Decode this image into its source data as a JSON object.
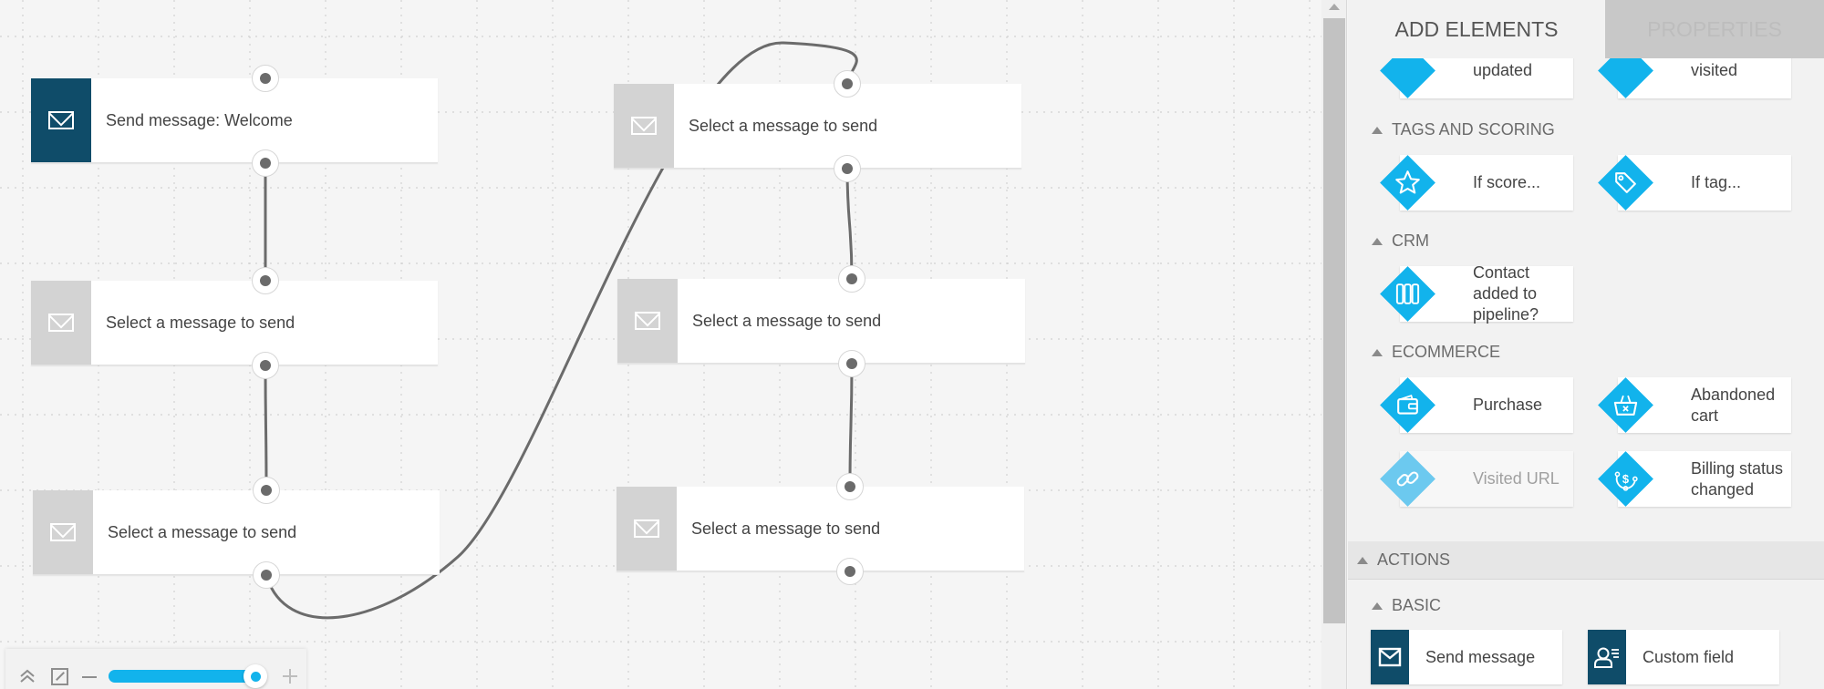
{
  "canvas": {
    "nodes": [
      {
        "label": "Send message: Welcome",
        "state": "active"
      },
      {
        "label": "Select a message to send",
        "state": "empty"
      },
      {
        "label": "Select a message to send",
        "state": "empty"
      },
      {
        "label": "Select a message to send",
        "state": "empty"
      },
      {
        "label": "Select a message to send",
        "state": "empty"
      },
      {
        "label": "Select a message to send",
        "state": "empty"
      }
    ],
    "connections": [
      {
        "from": 0,
        "to": 1
      },
      {
        "from": 1,
        "to": 2
      },
      {
        "from": 2,
        "to": 3
      },
      {
        "from": 3,
        "to": 4
      },
      {
        "from": 4,
        "to": 5
      }
    ],
    "zoom": {
      "collapse_icon": "double-chevron-up-icon",
      "fit_icon": "expand-icon",
      "minus_icon": "minus-icon",
      "plus_icon": "plus-icon",
      "level_fraction": 0.9
    }
  },
  "panel": {
    "tabs": [
      {
        "label": "ADD ELEMENTS",
        "active": true
      },
      {
        "label": "PROPERTIES",
        "active": false
      }
    ],
    "partial_cards": [
      {
        "label": "updated"
      },
      {
        "label": "visited"
      }
    ],
    "sections": {
      "tags_scoring": {
        "title": "TAGS AND SCORING",
        "items": [
          {
            "label": "If score...",
            "icon": "star-icon"
          },
          {
            "label": "If tag...",
            "icon": "tag-icon"
          }
        ]
      },
      "crm": {
        "title": "CRM",
        "items": [
          {
            "label": "Contact added to pipeline?",
            "icon": "pipeline-icon"
          }
        ]
      },
      "ecommerce": {
        "title": "ECOMMERCE",
        "items": [
          {
            "label": "Purchase",
            "icon": "wallet-icon"
          },
          {
            "label": "Abandoned cart",
            "icon": "basket-icon"
          },
          {
            "label": "Visited URL",
            "icon": "link-icon",
            "disabled": true
          },
          {
            "label": "Billing status changed",
            "icon": "billing-icon"
          }
        ]
      }
    },
    "actions": {
      "title": "ACTIONS",
      "basic": {
        "title": "BASIC",
        "items": [
          {
            "label": "Send message",
            "icon": "envelope-icon"
          },
          {
            "label": "Custom field",
            "icon": "custom-field-icon"
          }
        ]
      }
    }
  },
  "colors": {
    "accent": "#12b3ec",
    "node_active": "#0f4c69",
    "node_empty": "#d3d3d3",
    "wire": "#6b6b6b"
  }
}
